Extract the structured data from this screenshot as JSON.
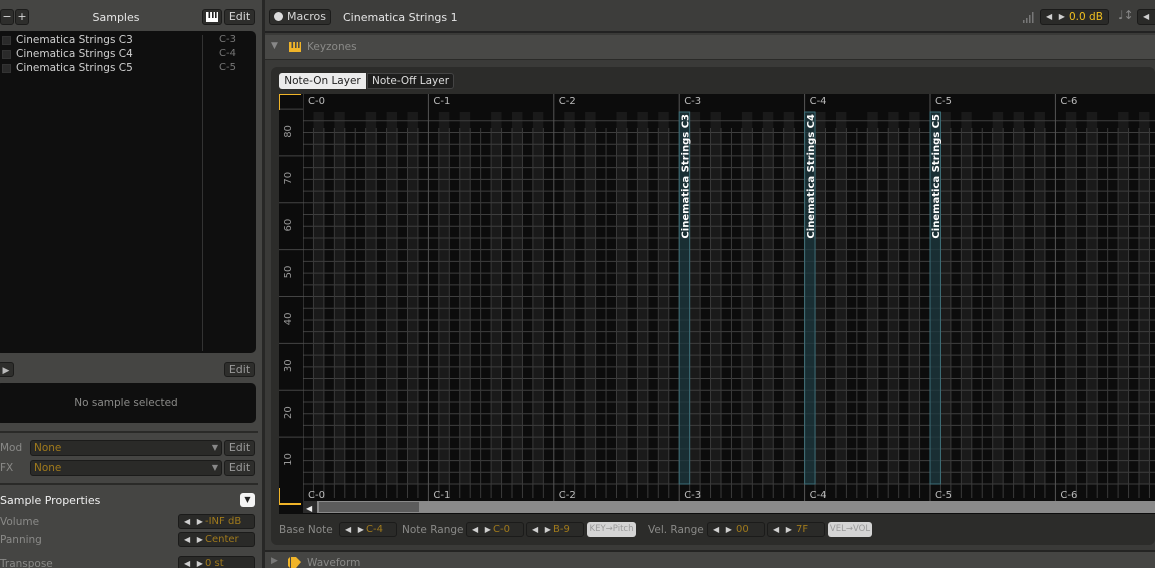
{
  "samples_panel": {
    "title": "Samples",
    "remove_label": "−",
    "add_label": "+",
    "keyboard_icon": "piano-keys-icon",
    "edit_label": "Edit",
    "items": [
      {
        "name": "Cinematica Strings C3",
        "root": "C-3"
      },
      {
        "name": "Cinematica Strings C4",
        "root": "C-4"
      },
      {
        "name": "Cinematica Strings C5",
        "root": "C-5"
      }
    ],
    "play_icon": "play-icon",
    "edit2_label": "Edit",
    "no_sample_text": "No sample selected",
    "mod": {
      "label": "Mod",
      "value": "None",
      "edit_label": "Edit"
    },
    "fx": {
      "label": "FX",
      "value": "None",
      "edit_label": "Edit"
    },
    "properties": {
      "title": "Sample Properties",
      "rows": [
        {
          "label": "Volume",
          "value": "-INF dB"
        },
        {
          "label": "Panning",
          "value": "Center"
        },
        {
          "label": "Transpose",
          "value": "0 st"
        }
      ]
    }
  },
  "header": {
    "macros_label": "Macros",
    "macros_icon": "knob-icon",
    "instrument_name": "Cinematica Strings 1",
    "volume_value": "0.0 dB",
    "level_icon": "signal-bars-icon",
    "pitch_icon": "note-updown-icon"
  },
  "keyzones": {
    "section_title": "Keyzones",
    "tabs": [
      {
        "label": "Note-On Layer",
        "active": true
      },
      {
        "label": "Note-Off Layer",
        "active": false
      }
    ],
    "octave_labels": [
      "C-0",
      "C-1",
      "C-2",
      "C-3",
      "C-4",
      "C-5",
      "C-6"
    ],
    "velocity_labels": [
      "80",
      "70",
      "60",
      "50",
      "40",
      "30",
      "20",
      "10"
    ],
    "zones": [
      {
        "name": "Cinematica Strings C3",
        "key_index": 36,
        "vel_low": 0,
        "vel_high": 127
      },
      {
        "name": "Cinematica Strings C4",
        "key_index": 48,
        "vel_low": 0,
        "vel_high": 127
      },
      {
        "name": "Cinematica Strings C5",
        "key_index": 60,
        "vel_low": 0,
        "vel_high": 127
      }
    ],
    "footer": {
      "base_note_label": "Base Note",
      "base_note_value": "C-4",
      "note_range_label": "Note Range",
      "note_range_low": "C-0",
      "note_range_high": "B-9",
      "key_pitch_label": "KEY→Pitch",
      "vel_range_label": "Vel. Range",
      "vel_low": "00",
      "vel_high": "7F",
      "vel_vol_label": "VEL→VOL"
    }
  },
  "waveform": {
    "section_title": "Waveform"
  },
  "colors": {
    "accent": "#f0b429",
    "value_text": "#a07a1c",
    "zone_fill": "#1e3a40",
    "zone_border": "#3d6e78"
  }
}
